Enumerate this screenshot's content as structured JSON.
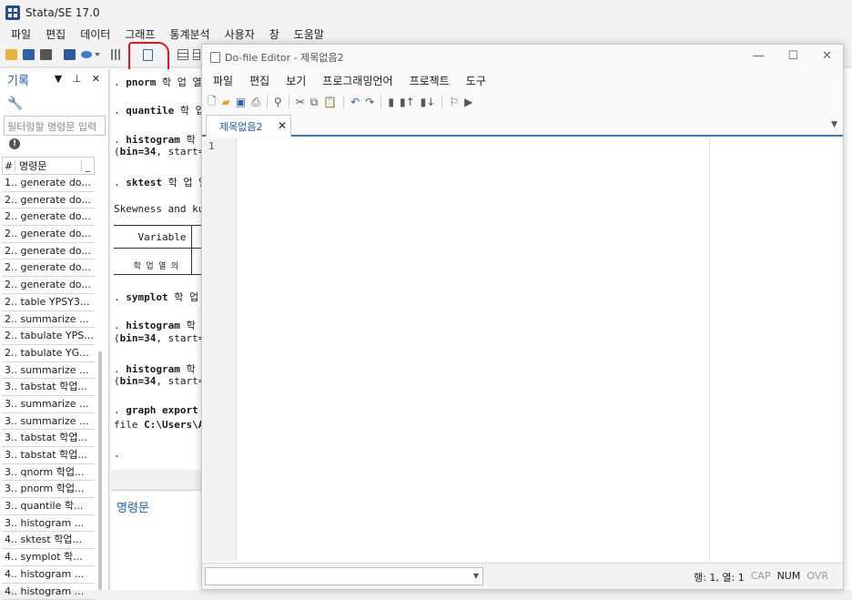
{
  "app": {
    "title": "Stata/SE 17.0",
    "menu": [
      "파일",
      "편집",
      "데이터",
      "그래프",
      "통계분석",
      "사용자",
      "창",
      "도움말"
    ]
  },
  "history": {
    "title": "기록",
    "controls": "▼ ⊥ ✕",
    "filter_placeholder": "필터링할 명령문 입력",
    "col_num": "#",
    "col_cmd": "명령문",
    "col_extra": "_",
    "rows": [
      "1.. generate do...",
      "2.. generate do...",
      "2.. generate do...",
      "2.. generate do...",
      "2.. generate do...",
      "2.. generate do...",
      "2.. generate do...",
      "2.. table YPSY3...",
      "2.. summarize ...",
      "2.. tabulate YPS...",
      "2.. tabulate YG...",
      "3.. summarize ...",
      "3.. tabstat 학업...",
      "3.. summarize ...",
      "3.. summarize ...",
      "3.. tabstat 학업...",
      "3.. tabstat 학업...",
      "3.. qnorm 학업...",
      "3.. pnorm 학업...",
      "3.. quantile 학...",
      "3.. histogram ...",
      "4.. sktest 학업...",
      "4.. symplot 학...",
      "4.. histogram ...",
      "4.. histogram ..."
    ]
  },
  "results": {
    "lines": [
      {
        "pre": ". ",
        "bold": "pnorm",
        "rest": " 학 업 열 의"
      },
      {
        "pre": ". ",
        "bold": "quantile",
        "rest": " 학 업"
      },
      {
        "pre": ". ",
        "bold": "histogram",
        "rest": " 학 업"
      },
      {
        "pre": "(",
        "bold": "bin=34",
        "rest": ", start="
      },
      {
        "pre": ". ",
        "bold": "sktest",
        "rest": " 학 업 열"
      },
      {
        "pre": "",
        "bold": "",
        "rest": "Skewness and ku"
      },
      {
        "pre": "",
        "bold": "",
        "rest": "    Variable"
      },
      {
        "pre": "",
        "bold": "",
        "rest": "    학 업 열 의"
      },
      {
        "pre": ". ",
        "bold": "symplot",
        "rest": " 학 업 열"
      },
      {
        "pre": ". ",
        "bold": "histogram",
        "rest": " 학 업"
      },
      {
        "pre": "(",
        "bold": "bin=34",
        "rest": ", start="
      },
      {
        "pre": ". ",
        "bold": "histogram",
        "rest": " 학 업"
      },
      {
        "pre": "(",
        "bold": "bin=34",
        "rest": ", start="
      },
      {
        "pre": ". ",
        "bold": "graph export",
        "rest": ""
      },
      {
        "pre": "file ",
        "bold": "C:\\Users\\A",
        "rest": ""
      },
      {
        "pre": ".",
        "bold": "",
        "rest": ""
      }
    ]
  },
  "command": {
    "title": "명령문"
  },
  "editor": {
    "title": "Do-file Editor - 제목없음2",
    "win_controls": [
      "—",
      "☐",
      "✕"
    ],
    "menu": [
      "파일",
      "편집",
      "보기",
      "프로그래밍언어",
      "프로젝트",
      "도구"
    ],
    "tab_label": "제목없음2",
    "tab_close": "✕",
    "line_number": "1",
    "status": {
      "position": "행: 1, 열: 1",
      "cap": "CAP",
      "num": "NUM",
      "ovr": "OVR"
    }
  },
  "colors": {
    "accent": "#1d5fb8",
    "highlight_box": "#e3131f"
  }
}
